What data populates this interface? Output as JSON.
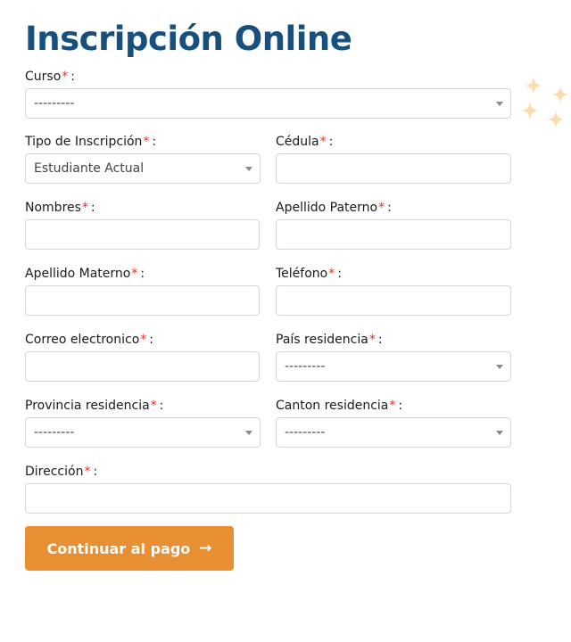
{
  "page": {
    "title": "Inscripción Online",
    "required_mark": "*",
    "colon": ":"
  },
  "form": {
    "curso": {
      "label": "Curso",
      "value": "---------"
    },
    "tipo_inscripcion": {
      "label": "Tipo de Inscripción",
      "value": "Estudiante Actual"
    },
    "cedula": {
      "label": "Cédula",
      "value": ""
    },
    "nombres": {
      "label": "Nombres",
      "value": ""
    },
    "apellido_paterno": {
      "label": "Apellido Paterno",
      "value": ""
    },
    "apellido_materno": {
      "label": "Apellido Materno",
      "value": ""
    },
    "telefono": {
      "label": "Teléfono",
      "value": ""
    },
    "correo": {
      "label": "Correo electronico",
      "value": ""
    },
    "pais_residencia": {
      "label": "País residencia",
      "value": "---------"
    },
    "provincia_residencia": {
      "label": "Provincia residencia",
      "value": "---------"
    },
    "canton_residencia": {
      "label": "Canton residencia",
      "value": "---------"
    },
    "direccion": {
      "label": "Dirección",
      "value": ""
    }
  },
  "submit": {
    "label": "Continuar al pago",
    "icon": "arrow-right-icon"
  },
  "decor": {
    "icon": "sparkles-icon",
    "color": "#fbdcae"
  },
  "colors": {
    "title": "#17507e",
    "button": "#e88f34",
    "required": "#e0332a",
    "border": "#d6d6d6"
  }
}
